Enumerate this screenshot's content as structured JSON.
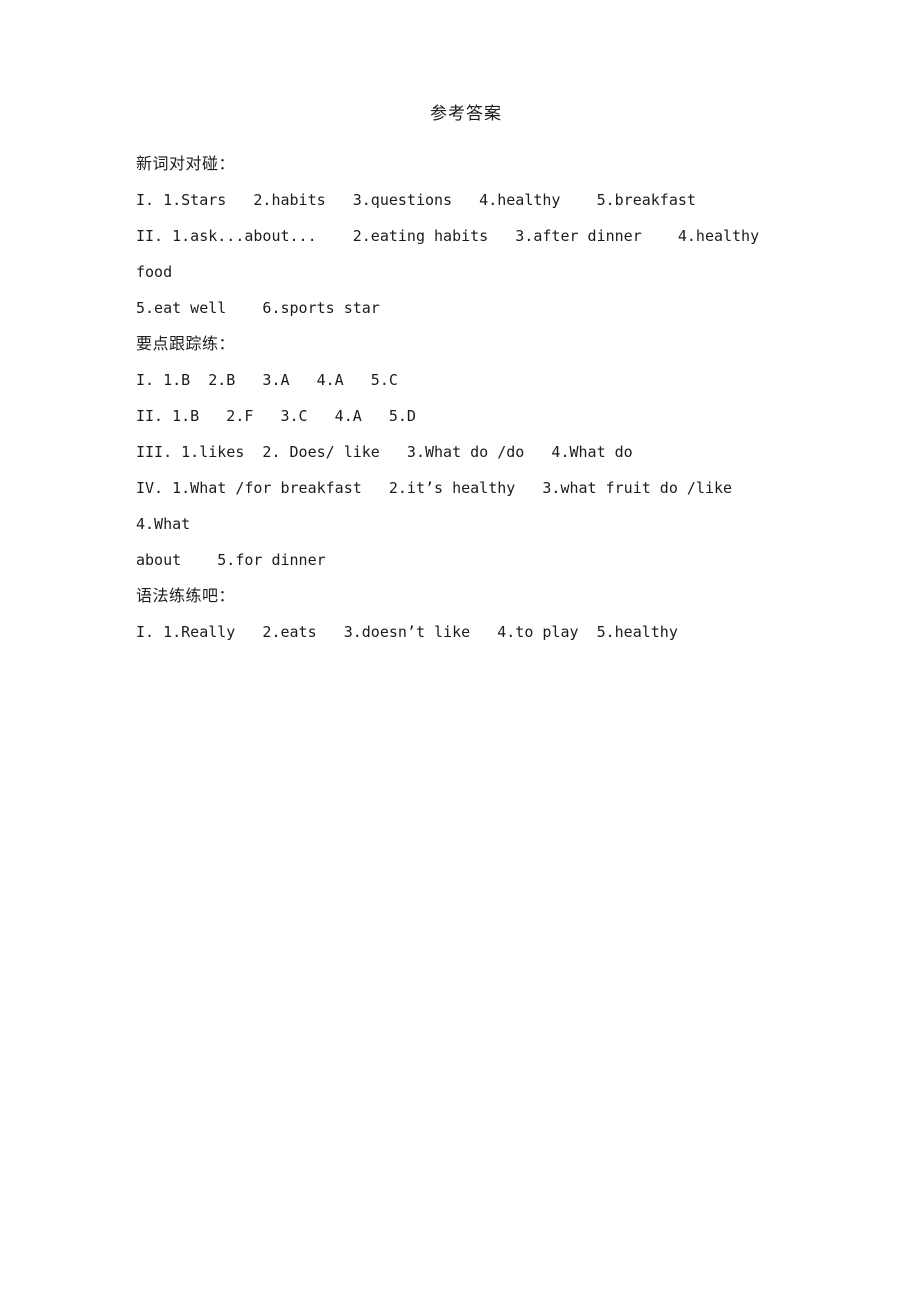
{
  "document": {
    "title": "参考答案",
    "page_background": "#ffffff",
    "text_color": "#1c1c1c",
    "sections": [
      {
        "heading": "新词对对碰：",
        "lines": [
          {
            "id": "s1-I",
            "text": "I. 1.Stars   2.habits   3.questions   4.healthy    5.breakfast",
            "continuation": false
          },
          {
            "id": "s1-II",
            "text": "II. 1.ask...about...    2.eating habits   3.after dinner    4.healthy food",
            "continuation": false
          },
          {
            "id": "s1-II-cont",
            "text": "5.eat well    6.sports star",
            "continuation": true
          }
        ]
      },
      {
        "heading": "要点跟踪练：",
        "lines": [
          {
            "id": "s2-I",
            "text": "I. 1.B  2.B   3.A   4.A   5.C",
            "continuation": false
          },
          {
            "id": "s2-II",
            "text": "II. 1.B   2.F   3.C   4.A   5.D",
            "continuation": false
          },
          {
            "id": "s2-III",
            "text": "III. 1.likes  2. Does/ like   3.What do /do   4.What do",
            "continuation": false
          },
          {
            "id": "s2-IV",
            "text": "IV. 1.What /for breakfast   2.it’s healthy   3.what fruit do /like   4.What",
            "continuation": false
          },
          {
            "id": "s2-IV-cont",
            "text": "about    5.for dinner",
            "continuation": true
          }
        ]
      },
      {
        "heading": "语法练练吧：",
        "lines": [
          {
            "id": "s3-I",
            "text": "I. 1.Really   2.eats   3.doesn’t like   4.to play  5.healthy",
            "continuation": false
          }
        ]
      }
    ]
  }
}
